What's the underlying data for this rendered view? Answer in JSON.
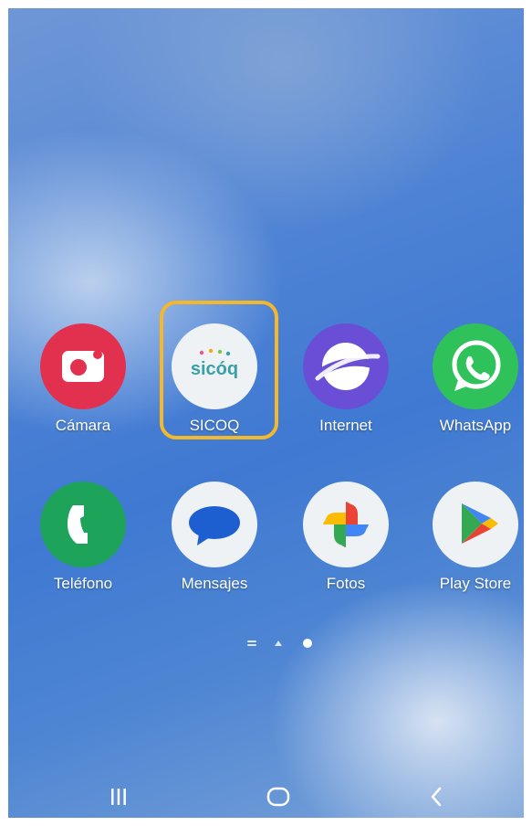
{
  "home_screen": {
    "row1": [
      {
        "label": "Cámara",
        "icon": "camera-icon",
        "color": "#e2314f"
      },
      {
        "label": "SICOQ",
        "icon": "sicoq-logo-icon",
        "color": "#eef2f5",
        "highlighted": true
      },
      {
        "label": "Internet",
        "icon": "samsung-internet-icon",
        "color": "#6a4fd6"
      },
      {
        "label": "WhatsApp",
        "icon": "whatsapp-icon",
        "color": "#2fc25a"
      }
    ],
    "row2": [
      {
        "label": "Teléfono",
        "icon": "phone-icon",
        "color": "#1ea35a"
      },
      {
        "label": "Mensajes",
        "icon": "messages-icon",
        "color": "#1d5fd1"
      },
      {
        "label": "Fotos",
        "icon": "google-photos-icon",
        "color": "#ffffff"
      },
      {
        "label": "Play Store",
        "icon": "play-store-icon",
        "color": "#ffffff"
      }
    ],
    "page_indicator": {
      "pages": 3,
      "current": 3
    },
    "sicoq_logo_text": "sicóq"
  },
  "nav_bar": {
    "recents": "recents-icon",
    "home": "home-icon",
    "back": "back-icon"
  }
}
